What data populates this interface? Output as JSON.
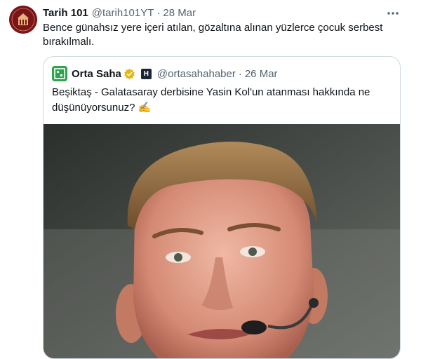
{
  "tweet": {
    "display_name": "Tarih 101",
    "handle": "@tarih101YT",
    "separator": "·",
    "date": "28 Mar",
    "text": "Bence günahsız yere içeri atılan, gözaltına alınan yüzlerce çocuk serbest bırakılmalı.",
    "avatar_icon": "tarih101-logo",
    "more_icon": "more-icon"
  },
  "quote": {
    "display_name": "Orta Saha",
    "handle": "@ortasahahaber",
    "separator": "·",
    "date": "26 Mar",
    "text": "Beşiktaş - Galatasaray derbisine Yasin Kol'un atanması hakkında ne düşünüyorsunuz? ✍️",
    "badge_letter": "H",
    "verified_color": "#e2b719",
    "logo_color": "#2ea44f"
  },
  "colors": {
    "text": "#0f1419",
    "secondary": "#536471",
    "border": "#cfd9de",
    "avatar_bg": "#7a1418"
  }
}
